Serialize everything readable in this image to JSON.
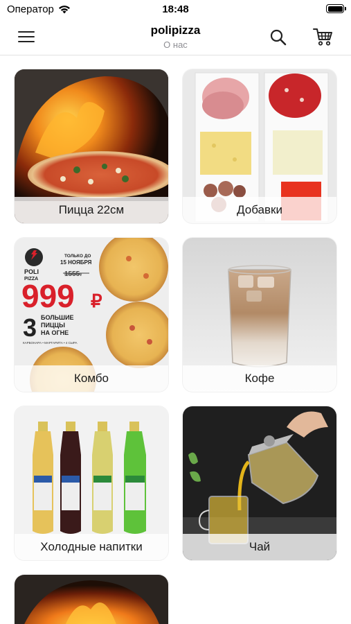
{
  "status_bar": {
    "carrier": "Оператор",
    "time": "18:48"
  },
  "nav": {
    "title": "polipizza",
    "subtitle": "О нас"
  },
  "icons": {
    "menu": "hamburger-icon",
    "search": "search-icon",
    "cart": "cart-icon",
    "wifi": "wifi-icon",
    "battery": "battery-icon"
  },
  "categories": [
    {
      "label": "Пицца 22см"
    },
    {
      "label": "Добавки"
    },
    {
      "label": "Комбо"
    },
    {
      "label": "Кофе"
    },
    {
      "label": "Холодные напитки"
    },
    {
      "label": "Чай"
    },
    {
      "label": ""
    }
  ],
  "combo_banner": {
    "brand_line1": "POLI",
    "brand_line2": "PIZZA",
    "promo_until": "ТОЛЬКО ДО",
    "promo_date": "15 НОЯБРЯ",
    "old_price": "1555.",
    "new_price": "999",
    "currency": "₽",
    "count": "3",
    "headline_line1": "БОЛЬШИЕ",
    "headline_line2": "ПИЦЦЫ",
    "headline_line3": "НА ОГНЕ",
    "pizzas_list": "КАРБОНАРА • МАРГАРИТА • 4 СЫРА"
  },
  "colors": {
    "accent_red": "#d9202a",
    "divider": "#e2e2e2",
    "subtitle_gray": "#8e8e93"
  }
}
